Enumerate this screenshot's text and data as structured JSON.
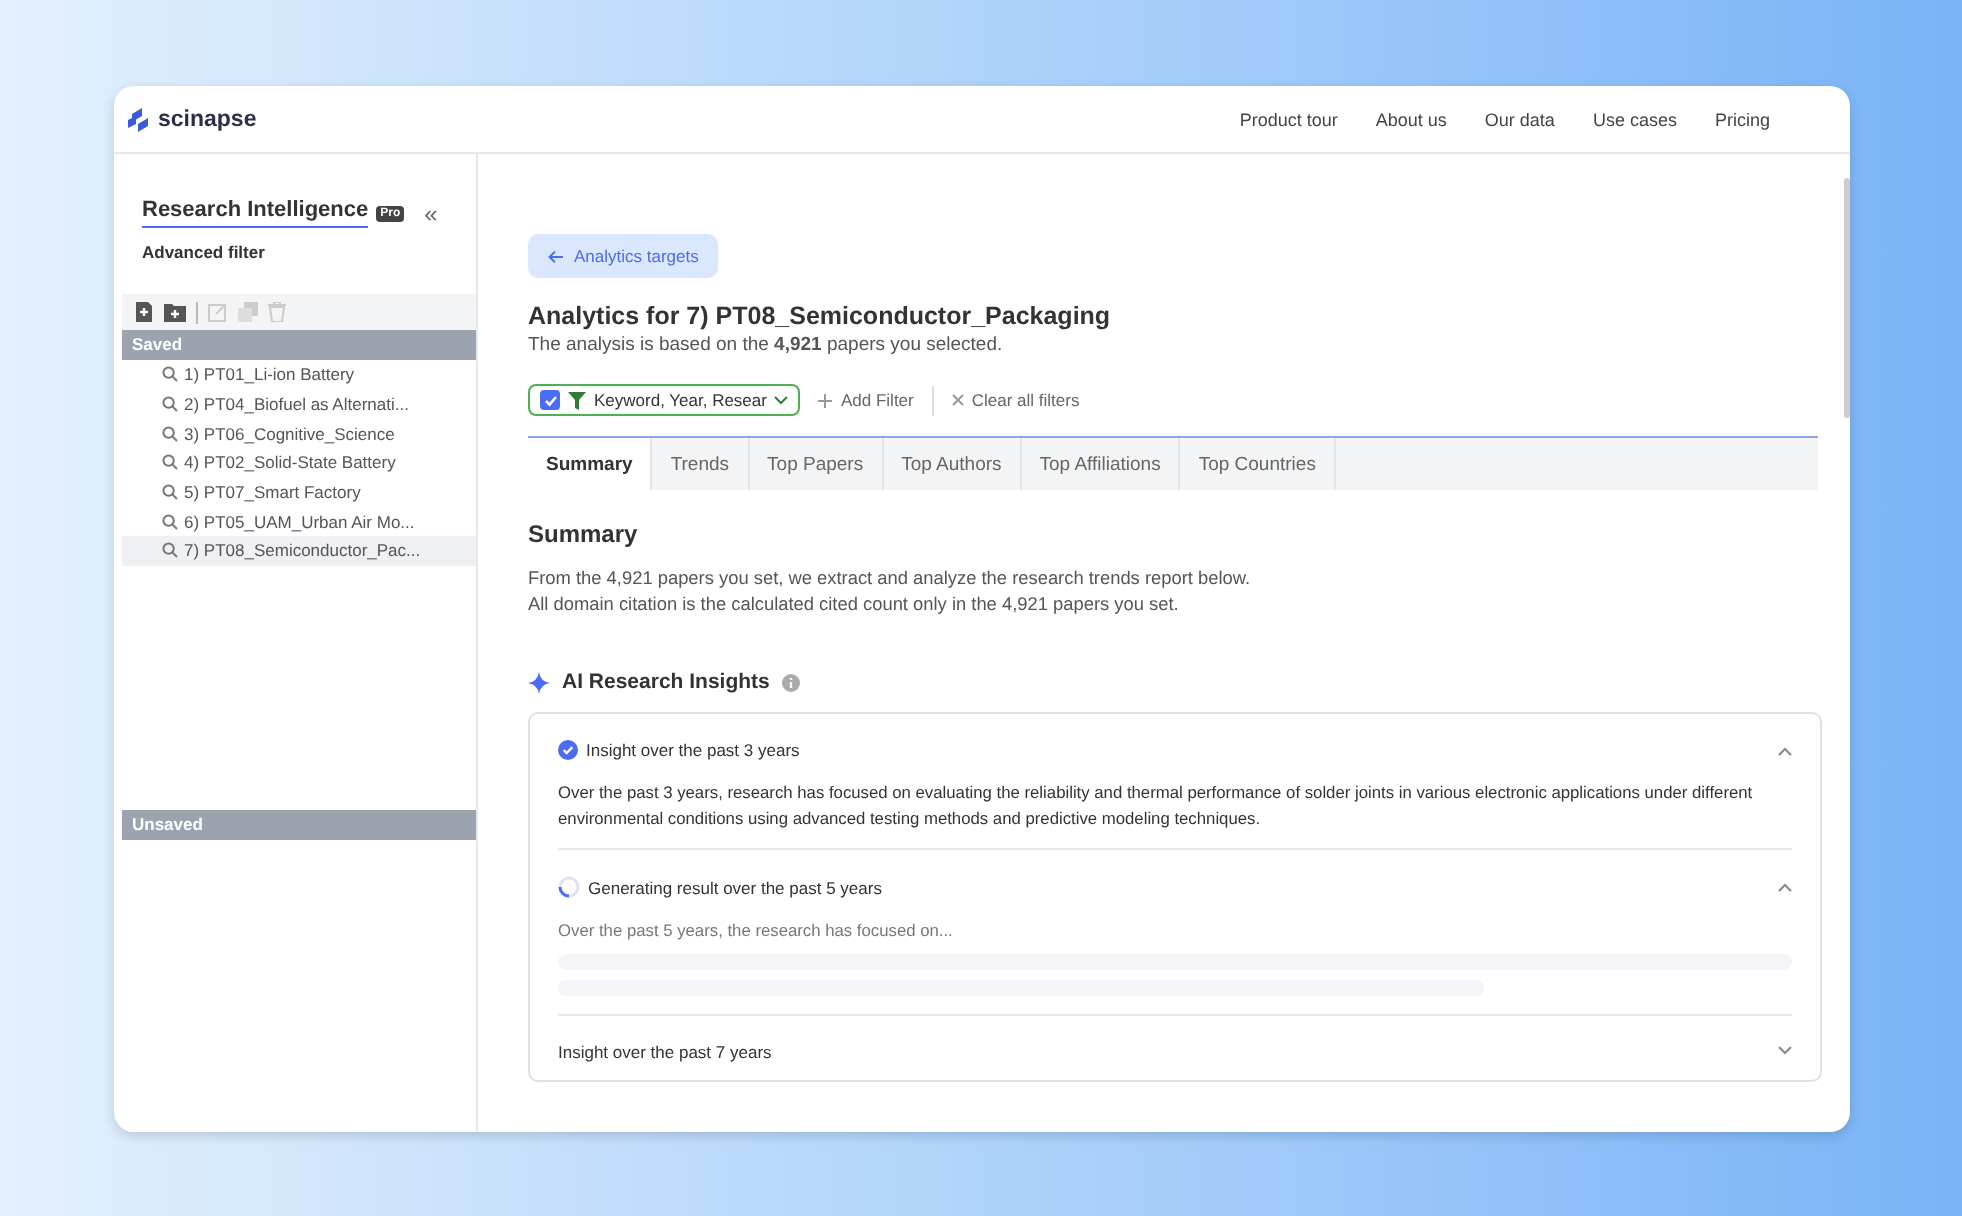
{
  "header": {
    "logo": "scinapse",
    "nav": [
      "Product tour",
      "About us",
      "Our data",
      "Use cases",
      "Pricing"
    ]
  },
  "sidebar": {
    "title": "Research Intelligence",
    "badge": "Pro",
    "collapse": "«",
    "subtitle": "Advanced filter",
    "saved_label": "Saved",
    "items": [
      {
        "label": "1) PT01_Li-ion Battery",
        "selected": false
      },
      {
        "label": "2) PT04_Biofuel as Alternati...",
        "selected": false
      },
      {
        "label": "3) PT06_Cognitive_Science",
        "selected": false
      },
      {
        "label": "4) PT02_Solid-State Battery",
        "selected": false
      },
      {
        "label": "5) PT07_Smart Factory",
        "selected": false
      },
      {
        "label": "6) PT05_UAM_Urban Air Mo...",
        "selected": false
      },
      {
        "label": "7) PT08_Semiconductor_Pac...",
        "selected": true
      }
    ],
    "unsaved_label": "Unsaved"
  },
  "main": {
    "back_button": "Analytics targets",
    "title": "Analytics for 7) PT08_Semiconductor_Packaging",
    "subtitle": "The analysis is based on the **4,921** papers you selected.",
    "filter": {
      "label": "Keyword, Year, Resear",
      "checked": true
    },
    "add_filter": "Add Filter",
    "clear_filters": "Clear all filters",
    "tabs": [
      {
        "label": "Summary",
        "selected": true
      },
      {
        "label": "Trends",
        "selected": false
      },
      {
        "label": "Top Papers",
        "selected": false
      },
      {
        "label": "Top Authors",
        "selected": false
      },
      {
        "label": "Top Affiliations",
        "selected": false
      },
      {
        "label": "Top Countries",
        "selected": false
      }
    ],
    "section_title": "Summary",
    "description": [
      "From the 4,921 papers you set, we extract and analyze the research trends report below.",
      "All domain citation is the calculated cited count only in the 4,921 papers you set."
    ],
    "insights_title": "AI Research Insights",
    "insights": [
      {
        "kind": "done",
        "title": "Insight over the past 3 years",
        "expanded": true,
        "text": "Over the past 3 years, research has focused on evaluating the reliability and thermal performance of solder joints in various electronic applications under different environmental conditions using advanced testing methods and predictive modeling techniques."
      },
      {
        "kind": "generating",
        "title": "Generating result over the past 5 years",
        "expanded": true,
        "text": "Over the past 5 years, the research has focused on..."
      },
      {
        "kind": "plain",
        "title": "Insight over the past 7 years",
        "expanded": false
      }
    ]
  }
}
